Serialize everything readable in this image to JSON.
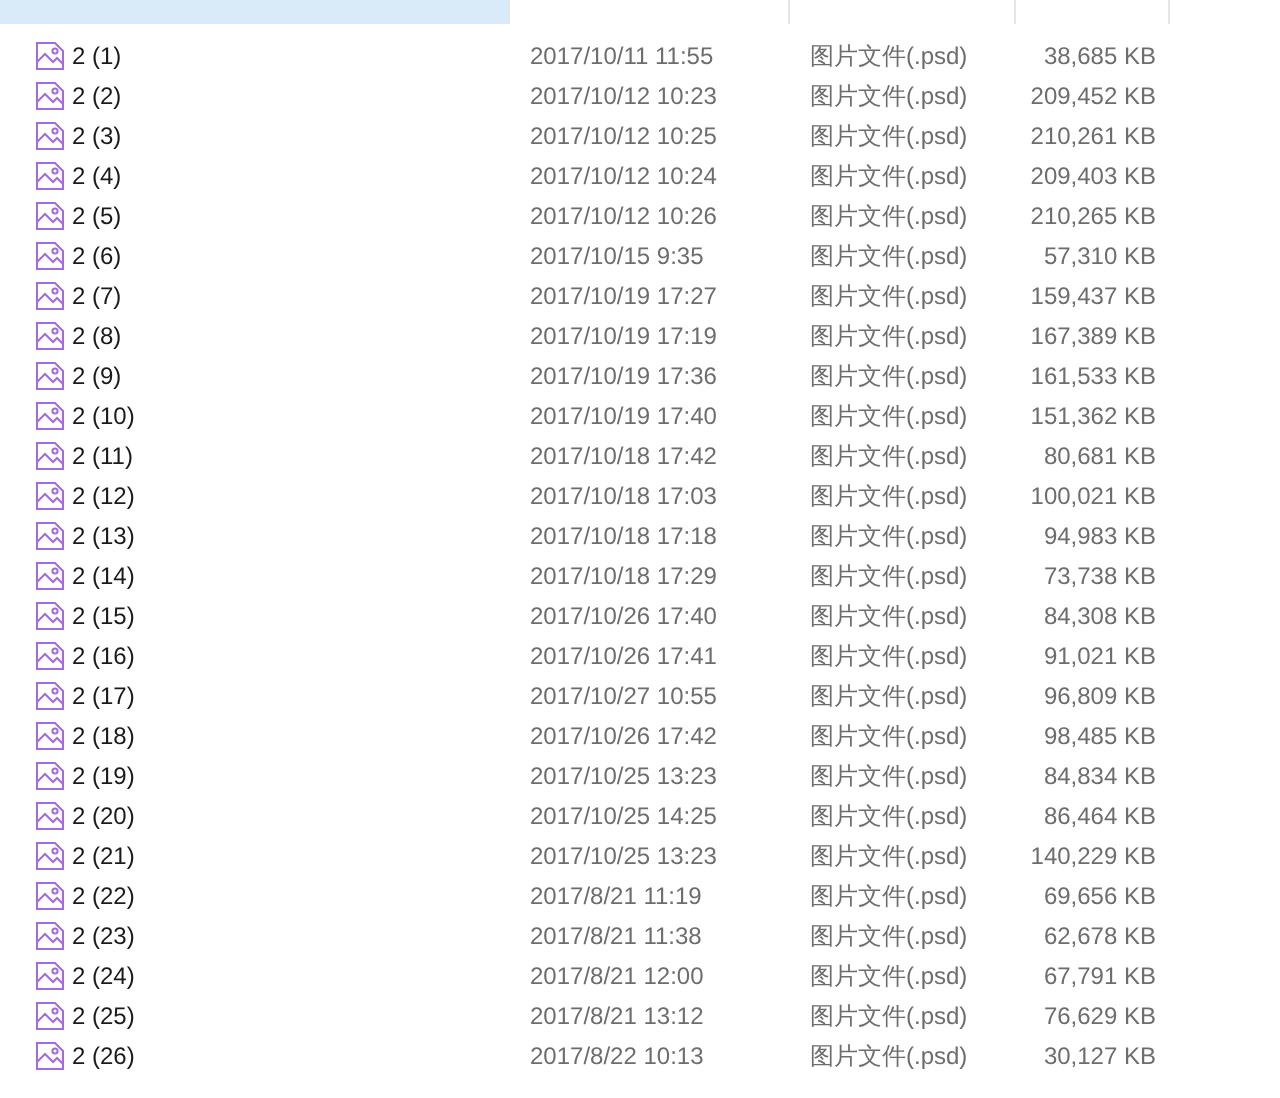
{
  "columns": [
    {
      "selected": true
    },
    {
      "selected": false
    },
    {
      "selected": false
    },
    {
      "selected": false
    }
  ],
  "rows": [
    {
      "name": "2 (1)",
      "date": "2017/10/11 11:55",
      "type": "图片文件(.psd)",
      "size": "38,685 KB"
    },
    {
      "name": "2 (2)",
      "date": "2017/10/12 10:23",
      "type": "图片文件(.psd)",
      "size": "209,452 KB"
    },
    {
      "name": "2 (3)",
      "date": "2017/10/12 10:25",
      "type": "图片文件(.psd)",
      "size": "210,261 KB"
    },
    {
      "name": "2 (4)",
      "date": "2017/10/12 10:24",
      "type": "图片文件(.psd)",
      "size": "209,403 KB"
    },
    {
      "name": "2 (5)",
      "date": "2017/10/12 10:26",
      "type": "图片文件(.psd)",
      "size": "210,265 KB"
    },
    {
      "name": "2 (6)",
      "date": "2017/10/15 9:35",
      "type": "图片文件(.psd)",
      "size": "57,310 KB"
    },
    {
      "name": "2 (7)",
      "date": "2017/10/19 17:27",
      "type": "图片文件(.psd)",
      "size": "159,437 KB"
    },
    {
      "name": "2 (8)",
      "date": "2017/10/19 17:19",
      "type": "图片文件(.psd)",
      "size": "167,389 KB"
    },
    {
      "name": "2 (9)",
      "date": "2017/10/19 17:36",
      "type": "图片文件(.psd)",
      "size": "161,533 KB"
    },
    {
      "name": "2 (10)",
      "date": "2017/10/19 17:40",
      "type": "图片文件(.psd)",
      "size": "151,362 KB"
    },
    {
      "name": "2 (11)",
      "date": "2017/10/18 17:42",
      "type": "图片文件(.psd)",
      "size": "80,681 KB"
    },
    {
      "name": "2 (12)",
      "date": "2017/10/18 17:03",
      "type": "图片文件(.psd)",
      "size": "100,021 KB"
    },
    {
      "name": "2 (13)",
      "date": "2017/10/18 17:18",
      "type": "图片文件(.psd)",
      "size": "94,983 KB"
    },
    {
      "name": "2 (14)",
      "date": "2017/10/18 17:29",
      "type": "图片文件(.psd)",
      "size": "73,738 KB"
    },
    {
      "name": "2 (15)",
      "date": "2017/10/26 17:40",
      "type": "图片文件(.psd)",
      "size": "84,308 KB"
    },
    {
      "name": "2 (16)",
      "date": "2017/10/26 17:41",
      "type": "图片文件(.psd)",
      "size": "91,021 KB"
    },
    {
      "name": "2 (17)",
      "date": "2017/10/27 10:55",
      "type": "图片文件(.psd)",
      "size": "96,809 KB"
    },
    {
      "name": "2 (18)",
      "date": "2017/10/26 17:42",
      "type": "图片文件(.psd)",
      "size": "98,485 KB"
    },
    {
      "name": "2 (19)",
      "date": "2017/10/25 13:23",
      "type": "图片文件(.psd)",
      "size": "84,834 KB"
    },
    {
      "name": "2 (20)",
      "date": "2017/10/25 14:25",
      "type": "图片文件(.psd)",
      "size": "86,464 KB"
    },
    {
      "name": "2 (21)",
      "date": "2017/10/25 13:23",
      "type": "图片文件(.psd)",
      "size": "140,229 KB"
    },
    {
      "name": "2 (22)",
      "date": "2017/8/21 11:19",
      "type": "图片文件(.psd)",
      "size": "69,656 KB"
    },
    {
      "name": "2 (23)",
      "date": "2017/8/21 11:38",
      "type": "图片文件(.psd)",
      "size": "62,678 KB"
    },
    {
      "name": "2 (24)",
      "date": "2017/8/21 12:00",
      "type": "图片文件(.psd)",
      "size": "67,791 KB"
    },
    {
      "name": "2 (25)",
      "date": "2017/8/21 13:12",
      "type": "图片文件(.psd)",
      "size": "76,629 KB"
    },
    {
      "name": "2 (26)",
      "date": "2017/8/22 10:13",
      "type": "图片文件(.psd)",
      "size": "30,127 KB"
    }
  ]
}
